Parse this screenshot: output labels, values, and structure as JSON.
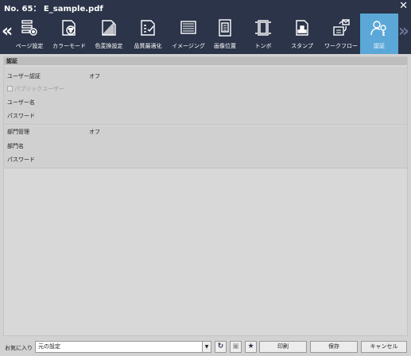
{
  "window": {
    "title": "No. 65： E_sample.pdf",
    "close_icon": "close-icon"
  },
  "tabs": [
    {
      "label": "ページ設定",
      "icon": "page-setup-icon"
    },
    {
      "label": "カラーモード",
      "icon": "color-mode-icon"
    },
    {
      "label": "色変換設定",
      "icon": "color-conversion-icon"
    },
    {
      "label": "品質最適化",
      "icon": "quality-checklist-icon"
    },
    {
      "label": "イメージング",
      "icon": "imaging-icon"
    },
    {
      "label": "画像位置",
      "icon": "image-position-icon"
    },
    {
      "label": "トンボ",
      "icon": "crop-marks-icon"
    },
    {
      "label": "スタンプ",
      "icon": "stamp-icon"
    },
    {
      "label": "ワークフロー",
      "icon": "workflow-icon"
    },
    {
      "label": "認証",
      "icon": "authentication-icon",
      "active": true
    }
  ],
  "section": {
    "title": "認証",
    "user_auth": {
      "label": "ユーザー認証",
      "value": "オフ"
    },
    "public_user": {
      "label": "パブリックユーザー",
      "checked": false,
      "disabled": true
    },
    "user_name": {
      "label": "ユーザー名"
    },
    "user_password": {
      "label": "パスワード"
    },
    "dept_mgmt": {
      "label": "部門管理",
      "value": "オフ"
    },
    "dept_name": {
      "label": "部門名"
    },
    "dept_password": {
      "label": "パスワード"
    }
  },
  "footer": {
    "favorites_label": "お気に入り",
    "favorites_value": "元の設定",
    "print_label": "印刷",
    "save_label": "保存",
    "cancel_label": "キャンセル"
  },
  "colors": {
    "header_bg": "#2b3449",
    "active_tab": "#5ba8d8",
    "panel_bg": "#d2d2d2"
  }
}
